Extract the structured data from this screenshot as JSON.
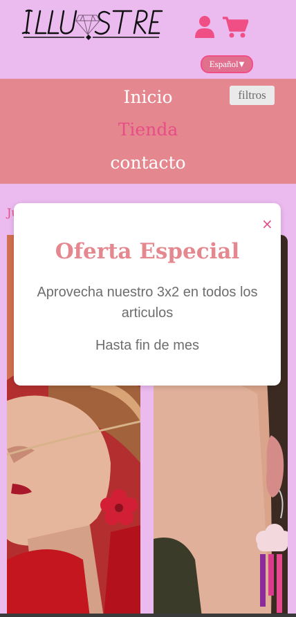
{
  "header": {
    "logo_text": "ILLUSTRE",
    "language_select": {
      "selected": "Español"
    }
  },
  "nav": {
    "items": [
      {
        "label": "Inicio",
        "active": false
      },
      {
        "label": "Tienda",
        "active": true
      },
      {
        "label": "contacto",
        "active": false
      }
    ],
    "filter_button": "filtros"
  },
  "page": {
    "partial_heading": "Ju"
  },
  "modal": {
    "title": "Oferta Especial",
    "body": "Aprovecha nuestro 3x2 en todos los articulos",
    "footer": "Hasta fin de mes",
    "close_icon": "×"
  },
  "colors": {
    "page_bg": "#ebbaef",
    "nav_bg": "#e5878f",
    "accent": "#e64d86",
    "modal_title": "#e5878f"
  },
  "icons": [
    "user-icon",
    "cart-icon",
    "close-icon",
    "chevron-down-icon"
  ]
}
